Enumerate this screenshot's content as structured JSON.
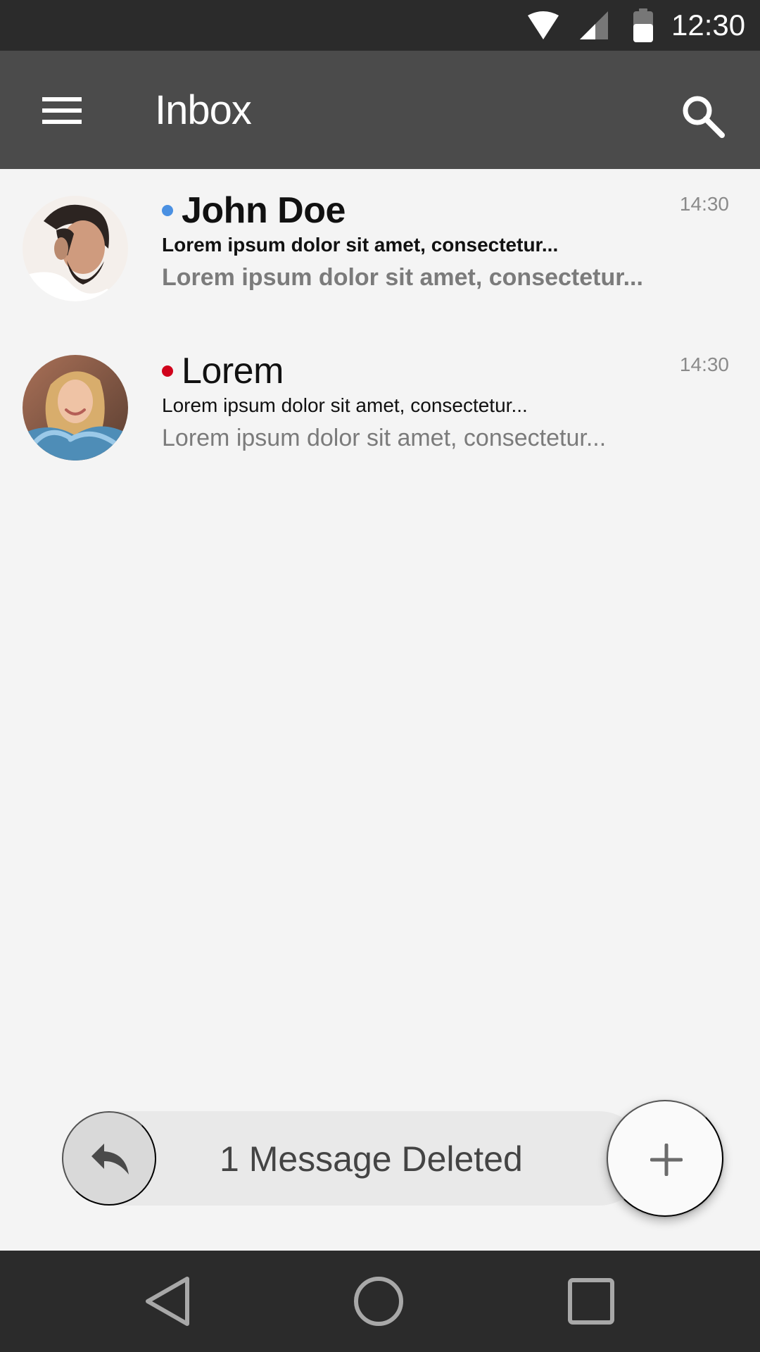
{
  "status_bar": {
    "time": "12:30",
    "icons": [
      "wifi-icon",
      "cell-signal-icon",
      "battery-icon"
    ]
  },
  "app_bar": {
    "title": "Inbox",
    "menu_icon": "hamburger-menu-icon",
    "search_icon": "search-icon"
  },
  "messages": [
    {
      "sender": "John Doe",
      "subject": "Lorem ipsum dolor sit amet, consectetur...",
      "preview": "Lorem ipsum dolor sit amet, consectetur...",
      "time": "14:30",
      "dot_color": "#4a90e2",
      "unread": true
    },
    {
      "sender": "Lorem",
      "subject": "Lorem ipsum dolor sit amet, consectetur...",
      "preview": "Lorem ipsum dolor sit amet, consectetur...",
      "time": "14:30",
      "dot_color": "#d0021b",
      "unread": false
    }
  ],
  "snackbar": {
    "message": "1 Message Deleted",
    "undo_icon": "undo-icon"
  },
  "fab": {
    "icon": "plus-icon"
  },
  "nav_bar": {
    "icons": [
      "back-icon",
      "home-icon",
      "recents-icon"
    ]
  },
  "colors": {
    "status_bar": "#2b2b2b",
    "app_bar": "#4b4b4b",
    "background": "#f4f4f4",
    "snackbar": "#e9e9e9",
    "undo_button": "#d9d9d9"
  }
}
